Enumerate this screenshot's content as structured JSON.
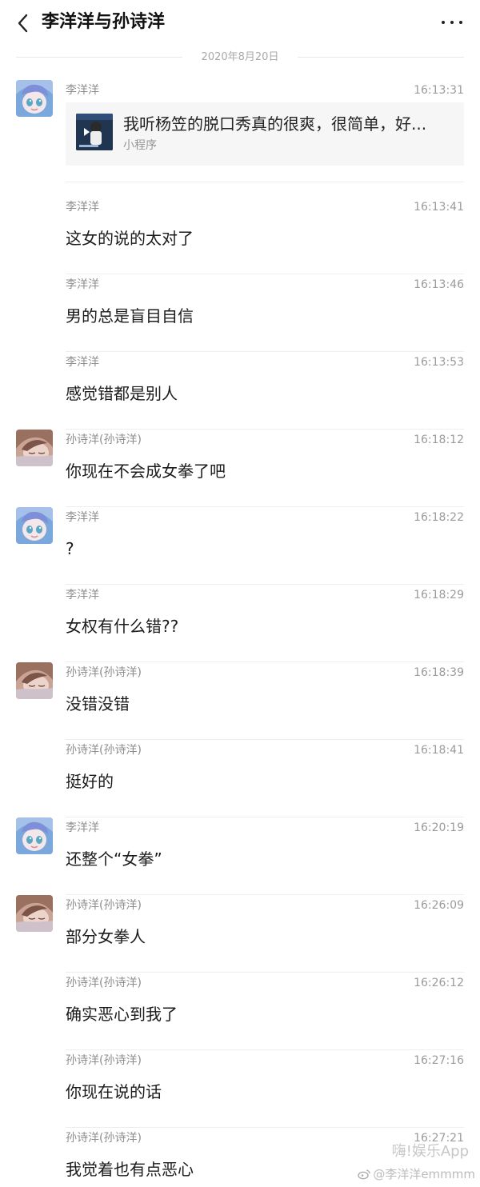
{
  "header": {
    "title": "李洋洋与孙诗洋",
    "back_icon": "chevron-left-icon",
    "more_icon": "more-horizontal-icon"
  },
  "date_divider": "2020年8月20日",
  "messages": [
    {
      "sender": "李洋洋",
      "time": "16:13:31",
      "type": "mini-program",
      "card_title": "我听杨笠的脱口秀真的很爽，很简单，好...",
      "card_subtitle": "小程序",
      "avatar": "li-avatar"
    },
    {
      "sender": "李洋洋",
      "time": "16:13:41",
      "text": "这女的说的太对了"
    },
    {
      "sender": "李洋洋",
      "time": "16:13:46",
      "text": "男的总是盲目自信"
    },
    {
      "sender": "李洋洋",
      "time": "16:13:53",
      "text": "感觉错都是别人"
    },
    {
      "sender": "孙诗洋(孙诗洋)",
      "time": "16:18:12",
      "text": "你现在不会成女拳了吧",
      "avatar": "sun-avatar"
    },
    {
      "sender": "李洋洋",
      "time": "16:18:22",
      "text": "?",
      "avatar": "li-avatar"
    },
    {
      "sender": "李洋洋",
      "time": "16:18:29",
      "text": "女权有什么错??"
    },
    {
      "sender": "孙诗洋(孙诗洋)",
      "time": "16:18:39",
      "text": "没错没错",
      "avatar": "sun-avatar"
    },
    {
      "sender": "孙诗洋(孙诗洋)",
      "time": "16:18:41",
      "text": "挺好的"
    },
    {
      "sender": "李洋洋",
      "time": "16:20:19",
      "text": "还整个“女拳”",
      "avatar": "li-avatar"
    },
    {
      "sender": "孙诗洋(孙诗洋)",
      "time": "16:26:09",
      "text": "部分女拳人",
      "avatar": "sun-avatar"
    },
    {
      "sender": "孙诗洋(孙诗洋)",
      "time": "16:26:12",
      "text": "确实恶心到我了"
    },
    {
      "sender": "孙诗洋(孙诗洋)",
      "time": "16:27:16",
      "text": "你现在说的话"
    },
    {
      "sender": "孙诗洋(孙诗洋)",
      "time": "16:27:21",
      "text": "我觉着也有点恶心"
    }
  ],
  "watermark": {
    "logo": "嗨!娱乐App",
    "account": "@李洋洋emmmm"
  },
  "colors": {
    "background": "#ffffff",
    "title": "#111111",
    "meta": "#9b9b9b",
    "message": "#1b1b1b",
    "card": "#f6f6f6"
  }
}
